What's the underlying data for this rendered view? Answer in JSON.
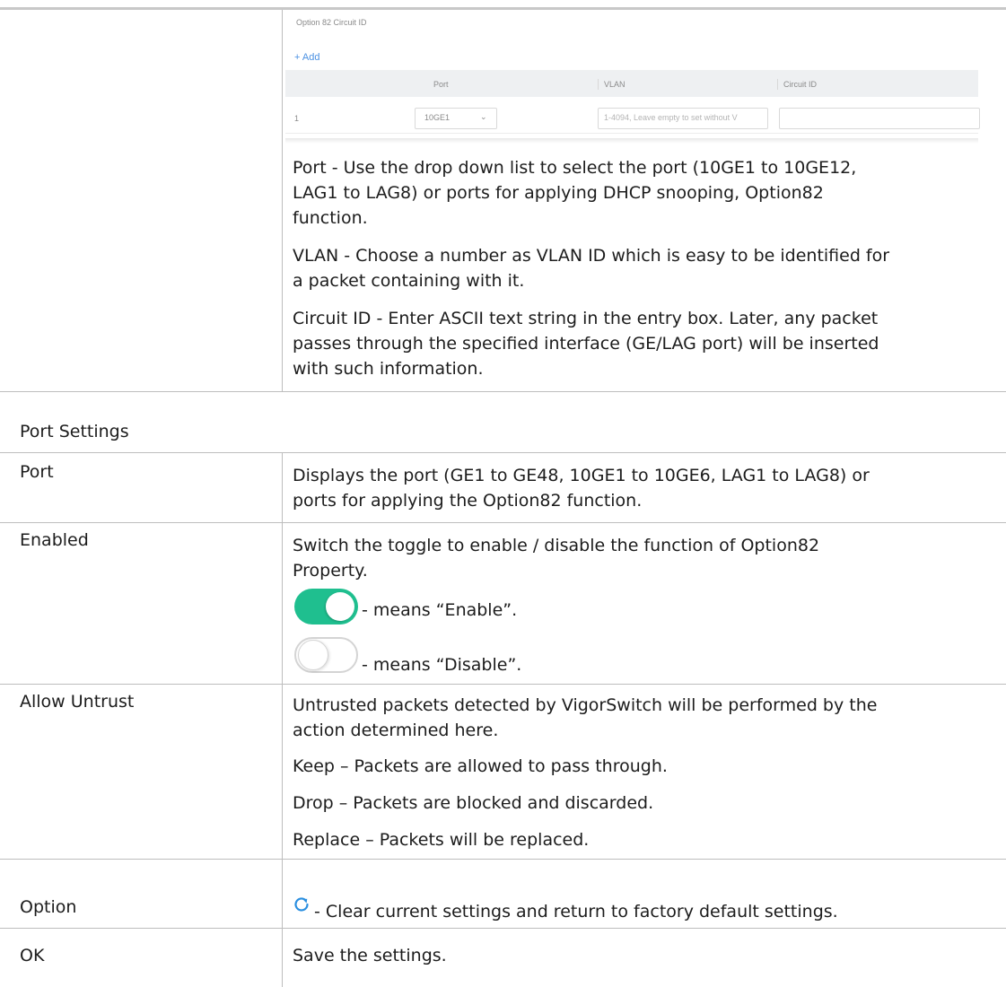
{
  "panel": {
    "section_label": "Option 82 Circuit ID",
    "add_label": "+ Add",
    "columns": [
      "Port",
      "VLAN",
      "Circuit ID"
    ],
    "row": {
      "index": "1",
      "port_value": "10GE1",
      "vlan_placeholder": "1-4094, Leave empty to set without V"
    }
  },
  "descriptions": {
    "port_lines": [
      "Port - Use the drop down list to select the port (10GE1 to 10GE12,",
      "LAG1 to LAG8) or ports for applying DHCP snooping, Option82",
      "function."
    ],
    "vlan_lines": [
      "VLAN - Choose a number as VLAN ID which is easy to be identified for",
      "a packet containing with it."
    ],
    "circuit_lines": [
      "Circuit ID - Enter ASCII text string in the entry box. Later, any packet",
      "passes through the specified interface (GE/LAG port) will be inserted",
      "with such information."
    ]
  },
  "section_header": "Port Settings",
  "rows": {
    "port": {
      "label": "Port",
      "lines": [
        "Displays the port (GE1 to GE48, 10GE1 to 10GE6, LAG1 to LAG8) or",
        "ports for applying the Option82 function."
      ]
    },
    "enabled": {
      "label": "Enabled",
      "lines": [
        "Switch the toggle to enable / disable the function of Option82",
        "Property."
      ],
      "enable_text": "- means “Enable”.",
      "disable_text": "- means “Disable”.",
      "toggle_on_color": "#1fbf8f"
    },
    "allow_untrust": {
      "label": "Allow Untrust",
      "lines": [
        "Untrusted packets detected by VigorSwitch will be performed by the",
        "action determined here."
      ],
      "keep": "Keep – Packets are allowed to pass through.",
      "drop": "Drop – Packets are blocked and discarded.",
      "replace": "Replace – Packets will be replaced."
    },
    "option": {
      "label": "Option",
      "text": "- Clear current settings and return to factory default settings.",
      "icon": "refresh-icon",
      "icon_color": "#2b8fe0"
    },
    "ok": {
      "label": "OK",
      "text": "Save the settings."
    }
  }
}
